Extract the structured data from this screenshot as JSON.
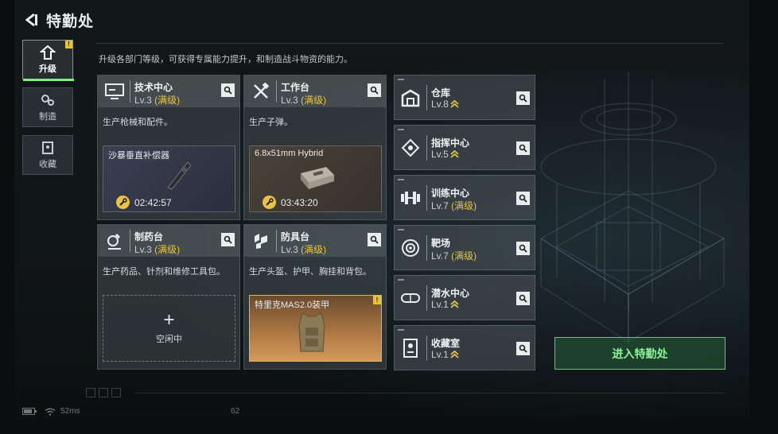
{
  "header": {
    "title": "特勤处"
  },
  "description": "升级各部门等级，可获得专属能力提升，和制造战斗物资的能力。",
  "tabs": [
    {
      "label": "升级",
      "active": true,
      "badge": "!"
    },
    {
      "label": "制造"
    },
    {
      "label": "收藏"
    }
  ],
  "cards": [
    {
      "name": "技术中心",
      "level": "Lv.3",
      "max": "(满级)",
      "desc": "生产枪械和配件。",
      "product": "沙暴垂直补偿器",
      "timer": "02:42:57",
      "icon": "computer-icon"
    },
    {
      "name": "工作台",
      "level": "Lv.3",
      "max": "(满级)",
      "desc": "生产子弹。",
      "product": "6.8x51mm Hybrid",
      "timer": "03:43:20",
      "icon": "tools-icon"
    },
    {
      "name": "制药台",
      "level": "Lv.3",
      "max": "(满级)",
      "desc": "生产药品、针剂和维修工具包。",
      "idle_label": "空闲中",
      "icon": "microscope-icon"
    },
    {
      "name": "防具台",
      "level": "Lv.3",
      "max": "(满级)",
      "desc": "生产头盔、护甲、胸挂和背包。",
      "product": "特里克MAS2.0装甲",
      "badge": "!",
      "icon": "armor-icon"
    }
  ],
  "facilities": [
    {
      "name": "仓库",
      "level": "Lv.8",
      "upgradable": true,
      "icon": "warehouse-icon"
    },
    {
      "name": "指挥中心",
      "level": "Lv.5",
      "upgradable": true,
      "icon": "chip-icon"
    },
    {
      "name": "训练中心",
      "level": "Lv.7",
      "max": "(满级)",
      "icon": "dumbbell-icon"
    },
    {
      "name": "靶场",
      "level": "Lv.7",
      "max": "(满级)",
      "icon": "target-icon"
    },
    {
      "name": "潜水中心",
      "level": "Lv.1",
      "upgradable": true,
      "icon": "diving-mask-icon"
    },
    {
      "name": "收藏室",
      "level": "Lv.1",
      "upgradable": true,
      "icon": "collection-icon"
    }
  ],
  "enter_button": "进入特勤处",
  "status": {
    "ping": "52ms",
    "fps": "62"
  },
  "colors": {
    "accent": "#7df07d",
    "max_level": "#e6c24a",
    "upgrade": "#e6c24a",
    "button_text": "#8ef29c"
  }
}
